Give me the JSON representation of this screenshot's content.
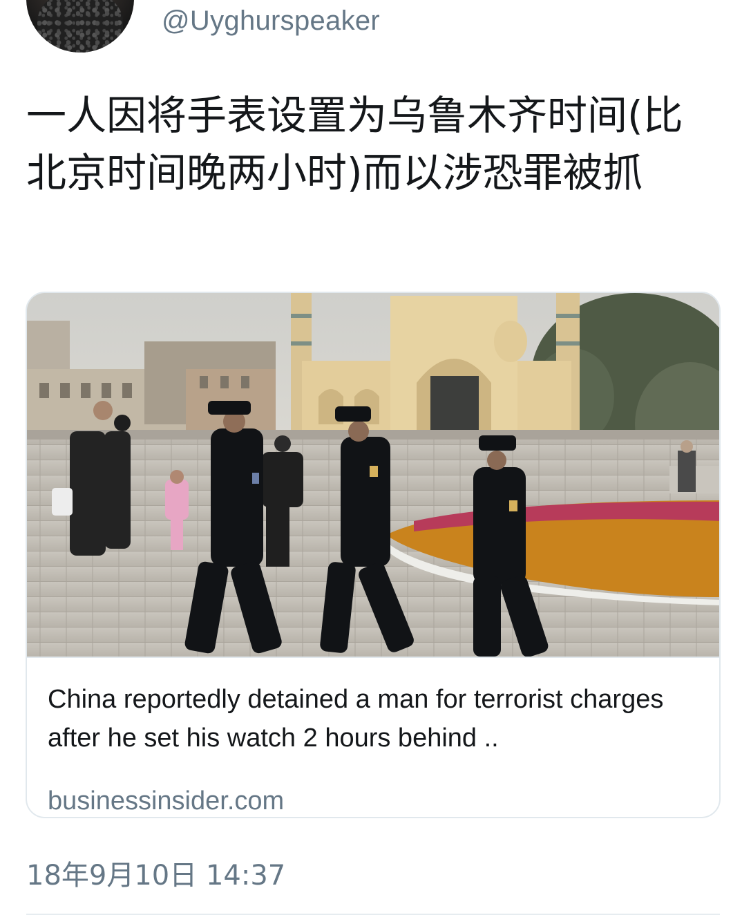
{
  "tweet": {
    "handle": "@Uyghurspeaker",
    "text": "一人因将手表设置为乌鲁木齐时间(比北京时间晚两小时)而以涉恐罪被抓",
    "timestamp": "18年9月10日 14:37"
  },
  "card": {
    "title": "China reportedly detained a man for terrorist charges after he set his watch 2 hours behind ..",
    "domain": "businessinsider.com"
  },
  "colors": {
    "text": "#14171a",
    "secondary": "#657786",
    "border": "#e1e8ed"
  }
}
